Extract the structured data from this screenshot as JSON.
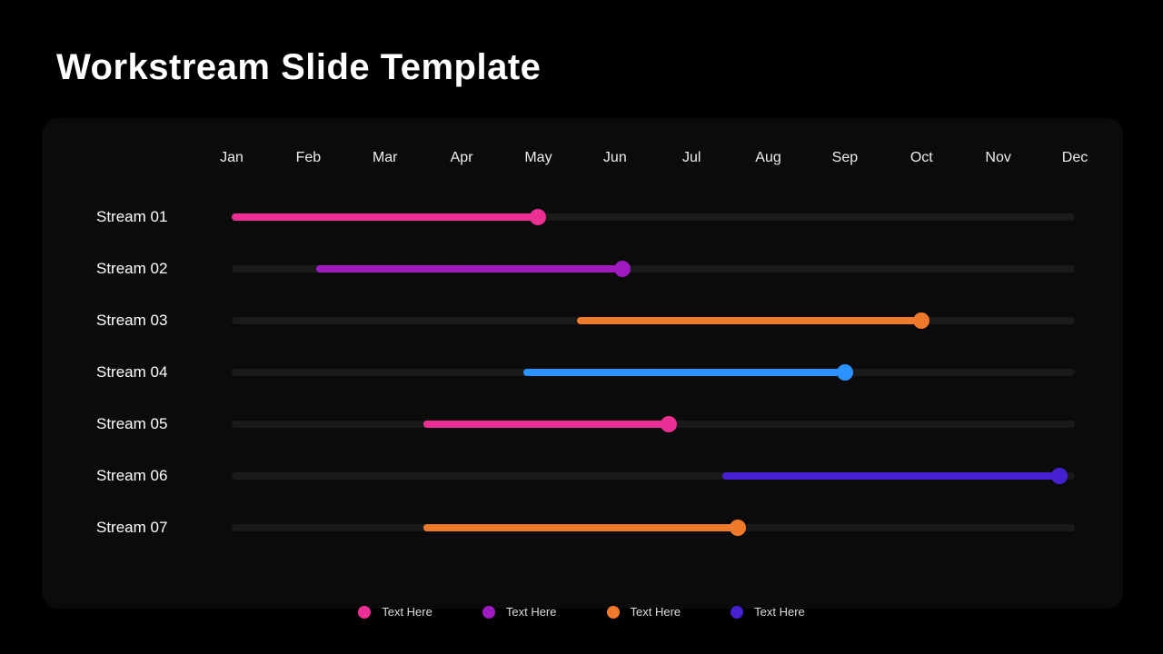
{
  "title": "Workstream Slide Template",
  "colors": {
    "pink": "#ec2f95",
    "purple": "#a01bbf",
    "orange": "#f07a2b",
    "blue": "#2a93ff",
    "indigo": "#4521d1"
  },
  "legend": [
    {
      "label": "Text Here",
      "color": "pink"
    },
    {
      "label": "Text Here",
      "color": "purple"
    },
    {
      "label": "Text Here",
      "color": "orange"
    },
    {
      "label": "Text Here",
      "color": "indigo"
    }
  ],
  "chart_data": {
    "type": "bar",
    "orientation": "horizontal-timeline",
    "title": "Workstream Slide Template",
    "xlabel": "",
    "ylabel": "",
    "categories": [
      "Jan",
      "Feb",
      "Mar",
      "Apr",
      "May",
      "Jun",
      "Jul",
      "Aug",
      "Sep",
      "Oct",
      "Nov",
      "Dec"
    ],
    "xlim": [
      1,
      12
    ],
    "series": [
      {
        "name": "Stream 01",
        "start": 1.0,
        "end": 5.0,
        "color": "pink"
      },
      {
        "name": "Stream 02",
        "start": 2.1,
        "end": 6.1,
        "color": "purple"
      },
      {
        "name": "Stream 03",
        "start": 5.5,
        "end": 10.0,
        "color": "orange"
      },
      {
        "name": "Stream 04",
        "start": 4.8,
        "end": 9.0,
        "color": "blue"
      },
      {
        "name": "Stream 05",
        "start": 3.5,
        "end": 6.7,
        "color": "pink"
      },
      {
        "name": "Stream 06",
        "start": 7.4,
        "end": 11.8,
        "color": "indigo"
      },
      {
        "name": "Stream 07",
        "start": 3.5,
        "end": 7.6,
        "color": "orange"
      }
    ],
    "grid": false,
    "legend_position": "bottom"
  }
}
